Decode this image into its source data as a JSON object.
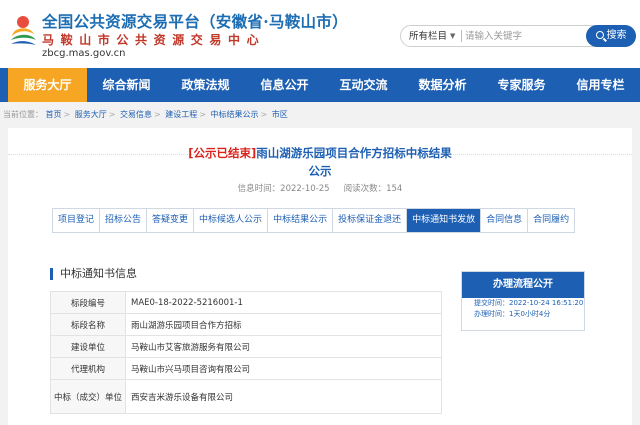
{
  "header": {
    "title": "全国公共资源交易平台（安徽省·马鞍山市）",
    "subtitle": "马鞍山市公共资源交易中心",
    "url": "zbcg.mas.gov.cn"
  },
  "search": {
    "scope": "所有栏目",
    "placeholder": "请输入关键字",
    "button_label": "搜索"
  },
  "nav": {
    "items": [
      {
        "label": "服务大厅",
        "active": true
      },
      {
        "label": "综合新闻",
        "active": false
      },
      {
        "label": "政策法规",
        "active": false
      },
      {
        "label": "信息公开",
        "active": false
      },
      {
        "label": "互动交流",
        "active": false
      },
      {
        "label": "数据分析",
        "active": false
      },
      {
        "label": "专家服务",
        "active": false
      },
      {
        "label": "信用专栏",
        "active": false
      }
    ]
  },
  "breadcrumb": {
    "prefix": "当前位置：",
    "items": [
      "首页",
      "服务大厅",
      "交易信息",
      "建设工程",
      "中标结果公示",
      "市区"
    ],
    "separator": ">"
  },
  "article": {
    "tag": "[公示已结束]",
    "title_line1": "雨山湖游乐园项目合作方招标中标结果",
    "title_line2": "公示",
    "date_label": "信息时间：",
    "date": "2022-10-25",
    "views_label": "阅读次数：",
    "views": "154"
  },
  "tabs": [
    {
      "label": "项目登记",
      "active": false
    },
    {
      "label": "招标公告",
      "active": false
    },
    {
      "label": "答疑变更",
      "active": false
    },
    {
      "label": "中标候选人公示",
      "active": false
    },
    {
      "label": "中标结果公示",
      "active": false
    },
    {
      "label": "投标保证金退还",
      "active": false
    },
    {
      "label": "中标通知书发放",
      "active": true
    },
    {
      "label": "合同信息",
      "active": false
    },
    {
      "label": "合同履约",
      "active": false
    }
  ],
  "section": {
    "title": "中标通知书信息",
    "rows": [
      {
        "key": "标段编号",
        "value": "MAE0-18-2022-5216001-1"
      },
      {
        "key": "标段名称",
        "value": "雨山湖游乐园项目合作方招标"
      },
      {
        "key": "建设单位",
        "value": "马鞍山市艾客旅游服务有限公司"
      },
      {
        "key": "代理机构",
        "value": "马鞍山市兴马项目咨询有限公司"
      },
      {
        "key": "中标（成交）单位",
        "value": "西安吉米游乐设备有限公司"
      }
    ]
  },
  "process": {
    "title": "办理流程公开",
    "submit_label": "提交时间：",
    "submit_time": "2022-10-24 16:51:20",
    "duration_label": "办理时间：",
    "duration": "1天0小时4分"
  },
  "colors": {
    "primary": "#1d5fb3",
    "active_nav": "#f6a623",
    "tag_red": "#d9241c",
    "subtitle_red": "#c0392b"
  }
}
